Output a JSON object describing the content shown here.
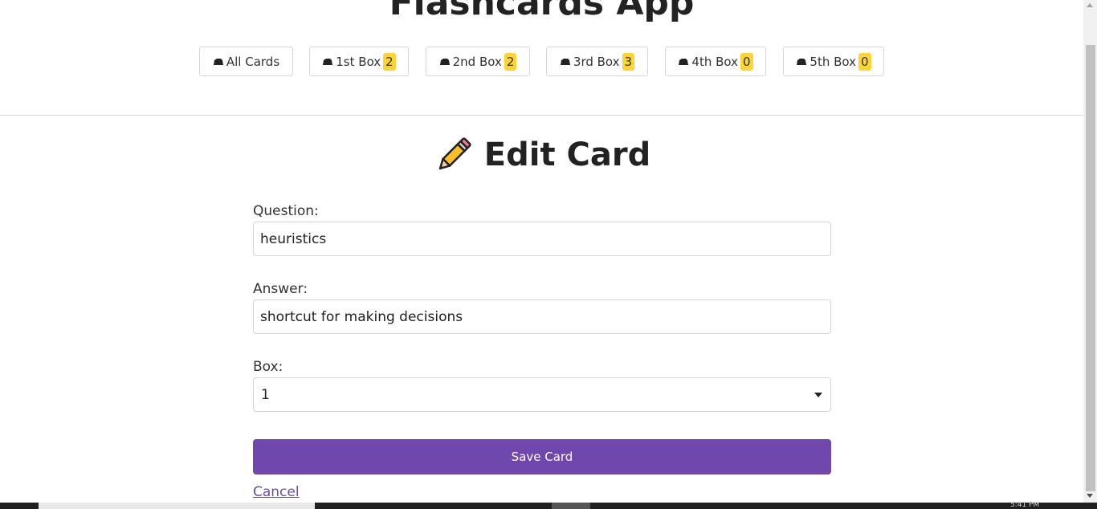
{
  "app": {
    "title": "Flashcards App"
  },
  "nav": [
    {
      "label": "All Cards",
      "badge": null
    },
    {
      "label": "1st Box",
      "badge": "2"
    },
    {
      "label": "2nd Box",
      "badge": "2"
    },
    {
      "label": "3rd Box",
      "badge": "3"
    },
    {
      "label": "4th Box",
      "badge": "0"
    },
    {
      "label": "5th Box",
      "badge": "0"
    }
  ],
  "edit": {
    "heading": "Edit Card",
    "question_label": "Question:",
    "question_value": "heuristics",
    "answer_label": "Answer:",
    "answer_value": "shortcut for making decisions",
    "box_label": "Box:",
    "box_value": "1",
    "save_label": "Save Card",
    "cancel_label": "Cancel"
  },
  "taskbar": {
    "clock": "5:41 PM"
  },
  "colors": {
    "accent": "#7048ad",
    "badge": "#fcd535",
    "link": "#6a4ba0"
  },
  "icons": {
    "nav": "card-box-icon",
    "heading": "pencil-icon"
  }
}
